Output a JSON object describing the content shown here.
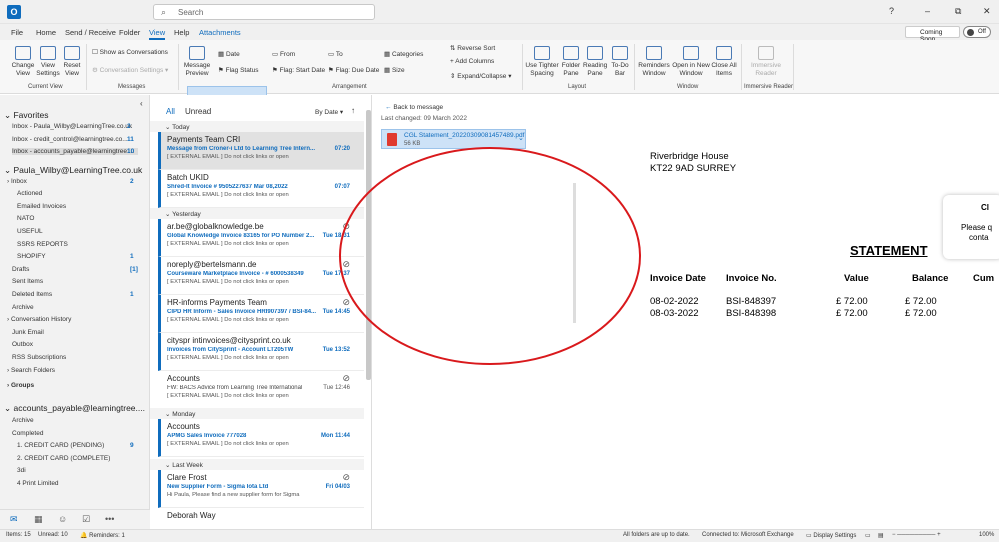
{
  "titlebar": {
    "search_placeholder": "Search"
  },
  "window_controls": [
    "?",
    "–",
    "⧉",
    "✕"
  ],
  "menu": {
    "items": [
      "File",
      "Home",
      "Send / Receive",
      "Folder",
      "View",
      "Help",
      "Attachments"
    ],
    "active": "View"
  },
  "coming_soon": {
    "label": "Coming Soon",
    "toggle": "Off"
  },
  "ribbon": {
    "change_view": "Change View",
    "view_settings": "View Settings",
    "reset_view": "Reset View",
    "show_as_conversations": "Show as Conversations",
    "conversation_settings": "Conversation Settings",
    "message_preview": "Message Preview",
    "date": "Date",
    "from": "From",
    "to": "To",
    "categories": "Categories",
    "flag_status": "Flag Status",
    "flag_start_date": "Flag: Start Date",
    "flag_due_date": "Flag: Due Date",
    "size": "Size",
    "reverse_sort": "Reverse Sort",
    "add_columns": "Add Columns",
    "expand_collapse": "Expand/Collapse",
    "use_tighter_spacing": "Use Tighter Spacing",
    "folder_pane": "Folder Pane",
    "reading_pane": "Reading Pane",
    "todo_bar": "To-Do Bar",
    "reminders_window": "Reminders Window",
    "open_in_new_window": "Open in New Window",
    "close_all_items": "Close All Items",
    "immersive_reader": "Immersive Reader",
    "groups": {
      "current_view": "Current View",
      "messages": "Messages",
      "arrangement": "Arrangement",
      "layout": "Layout",
      "window": "Window",
      "immersive_reader": "Immersive Reader"
    }
  },
  "nav": {
    "favorites": "Favorites",
    "fav_items": [
      {
        "label": "Inbox - Paula_Wilby@LearningTree.co.uk",
        "count": "2"
      },
      {
        "label": "Inbox - credit_control@learningtree.co...",
        "count": "11"
      },
      {
        "label": "Inbox - accounts_payable@learningtree....",
        "count": "10"
      }
    ],
    "account1": "Paula_Wilby@LearningTree.co.uk",
    "acc1_items": [
      {
        "label": "Inbox",
        "count": "2"
      },
      {
        "label": "Actioned",
        "count": ""
      },
      {
        "label": "Emailed Invoices",
        "count": ""
      },
      {
        "label": "NATO",
        "count": ""
      },
      {
        "label": "USEFUL",
        "count": ""
      },
      {
        "label": "SSRS REPORTS",
        "count": ""
      },
      {
        "label": "SHOPIFY",
        "count": "1"
      },
      {
        "label": "Drafts",
        "count": "[1]"
      },
      {
        "label": "Sent Items",
        "count": ""
      },
      {
        "label": "Deleted Items",
        "count": "1"
      },
      {
        "label": "Archive",
        "count": ""
      },
      {
        "label": "Conversation History",
        "count": ""
      },
      {
        "label": "Junk Email",
        "count": ""
      },
      {
        "label": "Outbox",
        "count": ""
      },
      {
        "label": "RSS Subscriptions",
        "count": ""
      },
      {
        "label": "Search Folders",
        "count": ""
      }
    ],
    "groups": "Groups",
    "account2": "accounts_payable@learningtree....",
    "acc2_items": [
      {
        "label": "Archive",
        "count": ""
      },
      {
        "label": "Completed",
        "count": ""
      },
      {
        "label": "1. CREDIT CARD (PENDING)",
        "count": "9"
      },
      {
        "label": "2. CREDIT CARD (COMPLETE)",
        "count": ""
      },
      {
        "label": "3di",
        "count": ""
      },
      {
        "label": "4 Print Limited",
        "count": ""
      }
    ]
  },
  "list": {
    "tab_all": "All",
    "tab_unread": "Unread",
    "sort": "By Date",
    "sections": {
      "today": "Today",
      "yesterday": "Yesterday",
      "monday": "Monday",
      "last_week": "Last Week"
    },
    "messages": [
      {
        "from": "Payments Team CRI",
        "subject": "Message from Croner-i Ltd to Learning Tree Intern...",
        "time": "07:20",
        "preview": "[ EXTERNAL EMAIL ] Do not click links or open"
      },
      {
        "from": "Batch UKID",
        "subject": "Shred-It Invoice # 9505227637 Mar 08,2022",
        "time": "07:07",
        "preview": "[ EXTERNAL EMAIL ] Do not click links or open"
      },
      {
        "from": "ar.be@globalknowledge.be",
        "subject": "Global Knowledge Invoice 83165 for PO Number 2...",
        "time": "Tue 18:31",
        "preview": "[ EXTERNAL EMAIL ] Do not click links or open"
      },
      {
        "from": "noreply@bertelsmann.de",
        "subject": "Courseware Marketplace Invoice - # 6000538349",
        "time": "Tue 17:37",
        "preview": "[ EXTERNAL EMAIL ] Do not click links or open"
      },
      {
        "from": "HR-informs Payments Team",
        "subject": "CIPD HR Inform - Sales Invoice  HRI907397 / BSI-84...",
        "time": "Tue 14:45",
        "preview": "[ EXTERNAL EMAIL ] Do not click links or open"
      },
      {
        "from": "cityspr intinvoices@citysprint.co.uk",
        "subject": "Invoices from CitySprint - Account LT205TW",
        "time": "Tue 13:52",
        "preview": "[ EXTERNAL EMAIL ] Do not click links or open"
      },
      {
        "from": "Accounts",
        "subject": "FW: BACS Advice from Learning Tree International",
        "time": "Tue 12:46",
        "preview": "[ EXTERNAL EMAIL ] Do not click links or open"
      },
      {
        "from": "Accounts",
        "subject": "APMG Sales Invoice 777028",
        "time": "Mon 11:44",
        "preview": "[ EXTERNAL EMAIL ] Do not click links or open"
      },
      {
        "from": "Clare Frost",
        "subject": "New Supplier Form  - Sigma Iota Ltd",
        "time": "Fri 04/03",
        "preview": "Hi Paula,  Please find a new supplier form for Sigma"
      },
      {
        "from": "Deborah Way",
        "subject": "",
        "time": "",
        "preview": ""
      }
    ]
  },
  "reading": {
    "back": "Back to message",
    "last_changed": "Last changed:  09 March 2022",
    "attachment_name": "CGL Statement_20220309081457489.pdf",
    "attachment_size": "56 KB",
    "address1": "Riverbridge House",
    "address2": "KT22 9AD  SURREY",
    "statement": "STATEMENT",
    "card_title": "Cl",
    "card_line1": "Please q",
    "card_line2": "conta",
    "headers": [
      "Invoice Date",
      "Invoice No.",
      "Value",
      "Balance",
      "Cum"
    ],
    "rows": [
      [
        "08-02-2022",
        "BSI-848397",
        "£ 72.00",
        "£ 72.00",
        ""
      ],
      [
        "08-03-2022",
        "BSI-848398",
        "£ 72.00",
        "£ 72.00",
        ""
      ]
    ]
  },
  "status": {
    "items": "Items: 15",
    "unread": "Unread: 10",
    "reminders": "Reminders: 1",
    "updated": "All folders are up to date.",
    "connected": "Connected to: Microsoft Exchange",
    "display_settings": "Display Settings",
    "zoom": "100%"
  },
  "colors": {
    "accent": "#0f6cbd",
    "annotation": "#d9191c"
  }
}
